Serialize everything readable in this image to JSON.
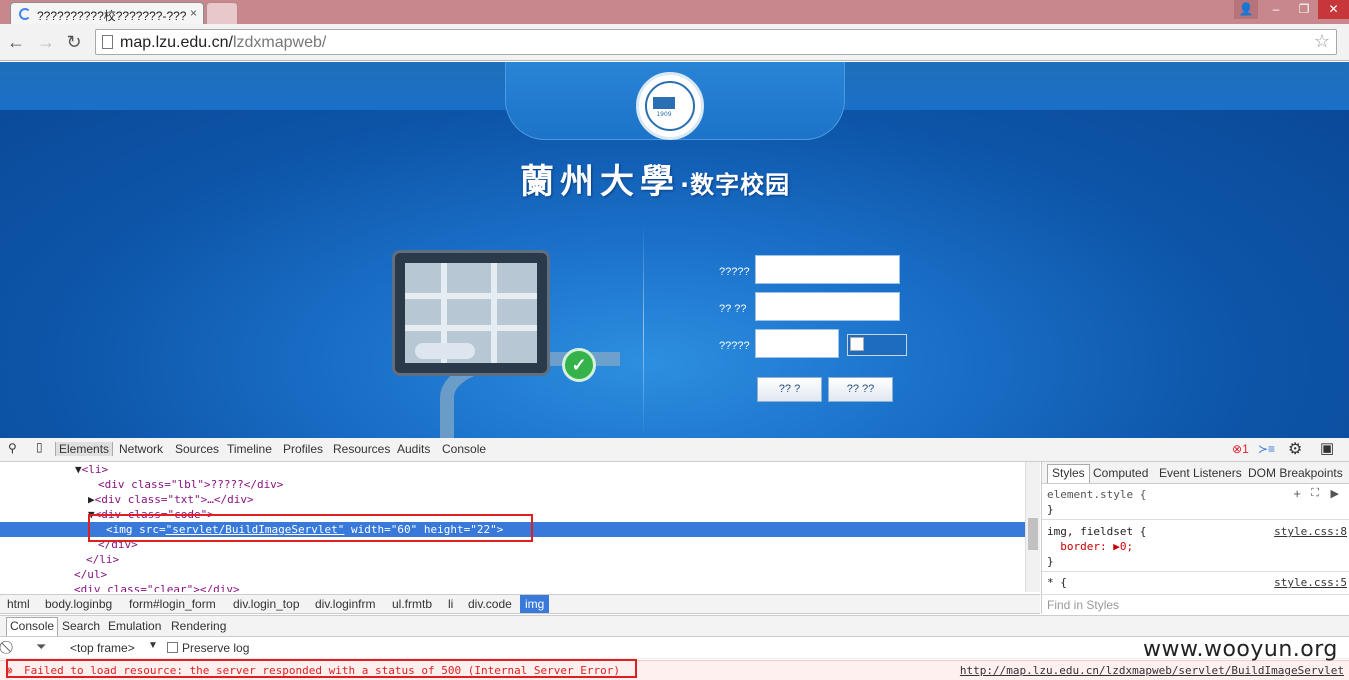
{
  "browser": {
    "tabs": [
      {
        "title": "??????????校???????-???"
      },
      {
        "title": ""
      }
    ],
    "close_glyph": "×",
    "window_buttons": {
      "user": "👤",
      "minimize": "‒",
      "restore": "❐",
      "close": "✕"
    },
    "nav": {
      "back": "←",
      "forward": "→",
      "reload": "↻"
    },
    "address": {
      "host": "map.lzu.edu.cn/",
      "path": "lzdxmapweb/"
    },
    "bookmark_star": "☆"
  },
  "page": {
    "seal_year": "1909",
    "site_title": "蘭州大學",
    "site_sub": "·数字校园",
    "form": {
      "username_label": "?????",
      "password_label": "?? ??",
      "code_label": "?????",
      "login_button": "?? ?",
      "reset_button": "?? ??"
    }
  },
  "devtools": {
    "tabs": [
      "Elements",
      "Network",
      "Sources",
      "Timeline",
      "Profiles",
      "Resources",
      "Audits",
      "Console"
    ],
    "error_count": "1",
    "elements_lines": [
      {
        "text": "<li>"
      },
      {
        "text": "<div class=\"lbl\">?????</div>"
      },
      {
        "text": "<div class=\"txt\">…</div>"
      },
      {
        "text": "<div class=\"code\">"
      },
      {
        "tag_open": "<img ",
        "attr1": "src=",
        "val1": "\"servlet/BuildImageServlet\"",
        "attr2": " width=",
        "val2": "\"60\"",
        "attr3": " height=",
        "val3": "\"22\"",
        "tag_close": ">"
      },
      {
        "text": "</div>"
      },
      {
        "text": "</li>"
      },
      {
        "text": "</ul>"
      },
      {
        "text": "<div class=\"clear\"></div>"
      }
    ],
    "breadcrumbs": [
      "html",
      "body.loginbg",
      "form#login_form",
      "div.login_top",
      "div.loginfrm",
      "ul.frmtb",
      "li",
      "div.code",
      "img"
    ],
    "styles_tabs": [
      "Styles",
      "Computed",
      "Event Listeners",
      "DOM Breakpoints"
    ],
    "styles": {
      "element_style": "element.style {",
      "close_brace": "}",
      "rule1_selector": "img, fieldset {",
      "rule1_prop": "  border: ▶0;",
      "rule1_source": "style.css:8",
      "rule2_selector": "* {",
      "rule2_source": "style.css:5",
      "find_placeholder": "Find in Styles"
    },
    "console_tabs": [
      "Console",
      "Search",
      "Emulation",
      "Rendering"
    ],
    "console_bar": {
      "frame": "<top frame>",
      "preserve": "Preserve log"
    },
    "console_error": "Failed to load resource: the server responded with a status of 500 (Internal Server Error)",
    "console_error_url": "http://map.lzu.edu.cn/lzdxmapweb/servlet/BuildImageServlet"
  },
  "watermark": "www.wooyun.org"
}
